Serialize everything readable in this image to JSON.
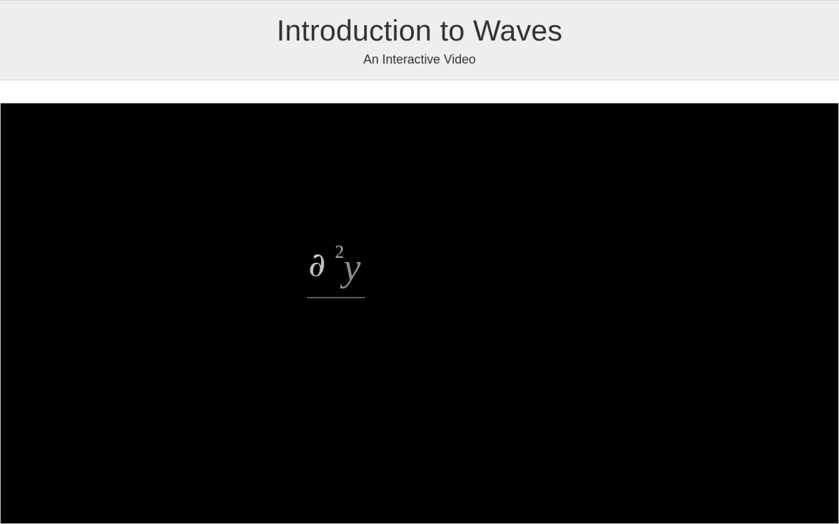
{
  "header": {
    "title": "Introduction to Waves",
    "subtitle": "An Interactive Video"
  },
  "video": {
    "equation": {
      "operator": "∂",
      "exponent": "2",
      "variable": "y"
    }
  },
  "colors": {
    "header_background": "#eeeeee",
    "header_text": "#333333",
    "video_background": "#000000"
  }
}
